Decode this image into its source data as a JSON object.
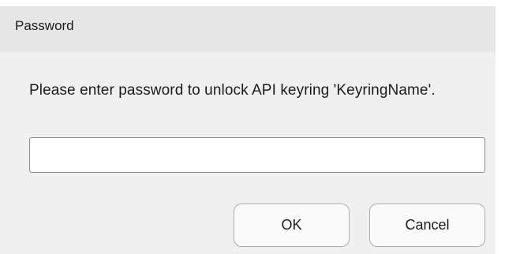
{
  "dialog": {
    "title": "Password",
    "message": "Please enter password to unlock API keyring 'KeyringName'.",
    "password_value": ""
  },
  "buttons": {
    "ok_label": "OK",
    "cancel_label": "Cancel"
  }
}
